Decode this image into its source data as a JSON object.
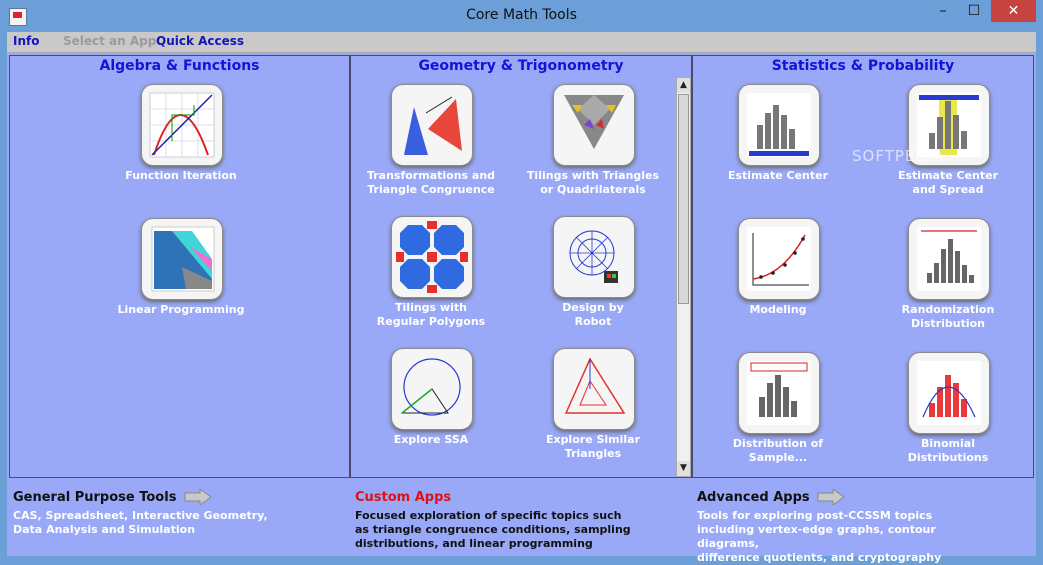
{
  "window": {
    "title": "Core Math Tools",
    "controls": {
      "minimize": "–",
      "maximize": "☐",
      "close": "✕"
    }
  },
  "menubar": {
    "info": "Info",
    "select_app": "Select an App:",
    "quick_access": "Quick Access"
  },
  "colors": {
    "background": "#99a9f7",
    "panel_title": "#1414d8",
    "custom_apps_heading": "#e01111"
  },
  "panels": [
    {
      "title": "Algebra & Functions",
      "tiles": [
        {
          "label": "Function Iteration",
          "icon": "function-iteration-icon"
        },
        {
          "label": "Linear Programming",
          "icon": "linear-programming-icon"
        }
      ]
    },
    {
      "title": "Geometry & Trigonometry",
      "tiles": [
        {
          "label": "Transformations and\nTriangle Congruence",
          "icon": "transformations-icon"
        },
        {
          "label": "Tilings with Triangles\nor Quadrilaterals",
          "icon": "tilings-triangles-icon"
        },
        {
          "label": "Tilings with\nRegular Polygons",
          "icon": "tilings-polygons-icon"
        },
        {
          "label": "Design by\nRobot",
          "icon": "design-robot-icon"
        },
        {
          "label": "Explore SSA",
          "icon": "explore-ssa-icon"
        },
        {
          "label": "Explore Similar\nTriangles",
          "icon": "similar-triangles-icon"
        }
      ]
    },
    {
      "title": "Statistics & Probability",
      "tiles": [
        {
          "label": "Estimate Center",
          "icon": "estimate-center-icon"
        },
        {
          "label": "Estimate Center\nand Spread",
          "icon": "estimate-spread-icon"
        },
        {
          "label": "Modeling",
          "icon": "modeling-icon"
        },
        {
          "label": "Randomization\nDistribution",
          "icon": "randomization-icon"
        },
        {
          "label": "Distribution of\nSample...",
          "icon": "sample-distribution-icon"
        },
        {
          "label": "Binomial\nDistributions",
          "icon": "binomial-icon"
        }
      ]
    }
  ],
  "footer": {
    "general": {
      "heading": "General Purpose Tools",
      "text": "CAS, Spreadsheet, Interactive Geometry,\nData Analysis and Simulation"
    },
    "custom": {
      "heading": "Custom Apps",
      "text": "Focused exploration of specific topics such\nas triangle congruence conditions, sampling\ndistributions, and linear programming"
    },
    "advanced": {
      "heading": "Advanced Apps",
      "text": "Tools for exploring post-CCSSM topics\nincluding vertex-edge graphs, contour diagrams,\ndifference quotients, and cryptography"
    }
  },
  "watermark": "SOFTPEDIA"
}
